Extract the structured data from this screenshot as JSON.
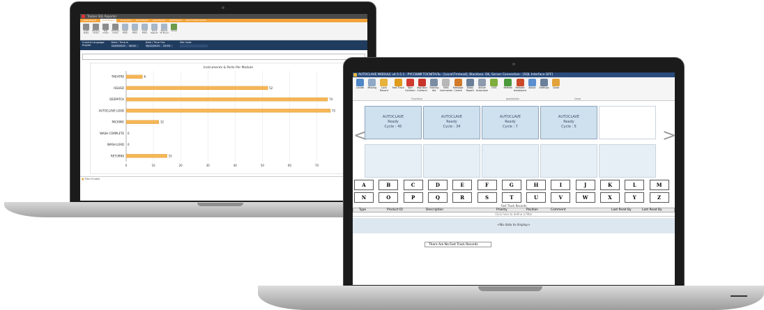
{
  "reporter": {
    "title": "Tracker SQL Reporter",
    "tabs": [
      "Asset Report",
      "Audit Report",
      "Production",
      "Fault Report",
      "Lead Report",
      "Staff Report",
      "Non Conformances"
    ],
    "ribbon": [
      "Audit Data",
      "Weekly Chart",
      "Year Chart",
      "Module Chart",
      "Clear Filter",
      "Save Filter",
      "Load Filter",
      "Print Report",
      "Export To Excel",
      "Close"
    ],
    "ribbon_groups": [
      "Audit Reports",
      "Audit Functions",
      "Close"
    ],
    "filters": {
      "language_label": "Current Language",
      "language_value": "English",
      "date_from_label": "Date / Time In",
      "date_from_value": "01/09/2015",
      "time_from_value": "00:00",
      "date_to_label": "Date / Time Out",
      "date_to_value": "30/12/2015",
      "time_to_value": "23:59",
      "site_label": "Site Code"
    },
    "footer": "Filter Enable"
  },
  "chart_data": {
    "type": "bar",
    "orientation": "horizontal",
    "title": "Instruments & Parts Per Module",
    "categories": [
      "THEATRE",
      "ISSUED",
      "DESPATCH",
      "AUTOCLAVE LOAD",
      "PACKING",
      "WASH COMPLETE",
      "WASH LOAD",
      "RETURNS"
    ],
    "values": [
      6,
      52,
      74,
      75,
      12,
      0,
      0,
      15
    ],
    "xlim": [
      0,
      75
    ],
    "xticks": [
      0,
      10,
      20,
      30,
      40,
      50,
      60,
      70
    ],
    "color": "#f6b655",
    "grid": true
  },
  "autoclave": {
    "title": "AUTOCLAVE MODULE v4.5.5.1 : PYCCKИЙ TOCNITAЛЬ : [Local\\Tmhead], Blackbox: OK, Server Connection : [SQL Interface OFF]",
    "ribbon": [
      {
        "label": "Locate",
        "icon": "locate-icon",
        "color": "#4f86c6"
      },
      {
        "label": "Missing",
        "icon": "missing-icon",
        "color": "#8fa9c7"
      },
      {
        "label": "Lock Record",
        "icon": "lock-icon",
        "color": "#e7b23c"
      },
      {
        "label": "Fast Track",
        "icon": "fast-track-icon",
        "color": "#e09a1c"
      },
      {
        "label": "Non Conform",
        "icon": "non-conform-icon",
        "color": "#d23a30"
      },
      {
        "label": "Mgt Non Conform",
        "icon": "mgt-non-conform-icon",
        "color": "#c8342a"
      },
      {
        "label": "Training Aid",
        "icon": "training-icon",
        "color": "#7a8da3"
      },
      {
        "label": "EBIS Comments",
        "icon": "comments-icon",
        "color": "#b7b7b7"
      },
      {
        "label": "Message Centre",
        "icon": "message-icon",
        "color": "#d27a2a"
      },
      {
        "label": "Today Report",
        "icon": "report-icon",
        "color": "#6c7f99"
      },
      {
        "label": "Active Autoclave",
        "icon": "autoclave-icon",
        "color": "#8f9aad"
      },
      {
        "label": "OOS",
        "icon": "oos-icon",
        "color": "#7fae3c"
      },
      {
        "label": "Refresh",
        "icon": "refresh-icon",
        "color": "#4a9a3c"
      },
      {
        "label": "Remote Assistance",
        "icon": "remote-icon",
        "color": "#cc4a2a"
      },
      {
        "label": "About",
        "icon": "about-icon",
        "color": "#5b8fcf"
      },
      {
        "label": "Settings",
        "icon": "settings-icon",
        "color": "#6a7f99"
      },
      {
        "label": "Close",
        "icon": "close-icon",
        "color": "#e3a33a"
      }
    ],
    "groups": [
      "Functions",
      "Application",
      "Close"
    ],
    "tiles": [
      {
        "name": "AUTOCLAVE",
        "status": "Ready",
        "cycle": "Cycle : 45"
      },
      {
        "name": "AUTOCLAVE",
        "status": "Ready",
        "cycle": "Cycle : 34"
      },
      {
        "name": "AUTOCLAVE",
        "status": "Ready",
        "cycle": "Cycle : 7"
      },
      {
        "name": "AUTOCLAVE",
        "status": "Ready",
        "cycle": "Cycle : 5"
      }
    ],
    "arrow_left": "<",
    "arrow_right": ">",
    "letters_row1": [
      "A",
      "B",
      "C",
      "D",
      "E",
      "F",
      "G",
      "H",
      "I",
      "J",
      "K",
      "L",
      "M"
    ],
    "letters_row2": [
      "N",
      "O",
      "P",
      "Q",
      "R",
      "S",
      "T",
      "U",
      "V",
      "W",
      "X",
      "Y",
      "Z"
    ],
    "fast_track_title": "Fast Track Records",
    "columns": [
      "Type",
      "Product ID",
      "Description",
      "Priority",
      "Position",
      "Comment",
      "Last Read By",
      "Last Read By"
    ],
    "filter_hint": "Click here to define a filter",
    "no_data": "<No data to display>",
    "status_text": "There Are No Fast Track Records"
  }
}
